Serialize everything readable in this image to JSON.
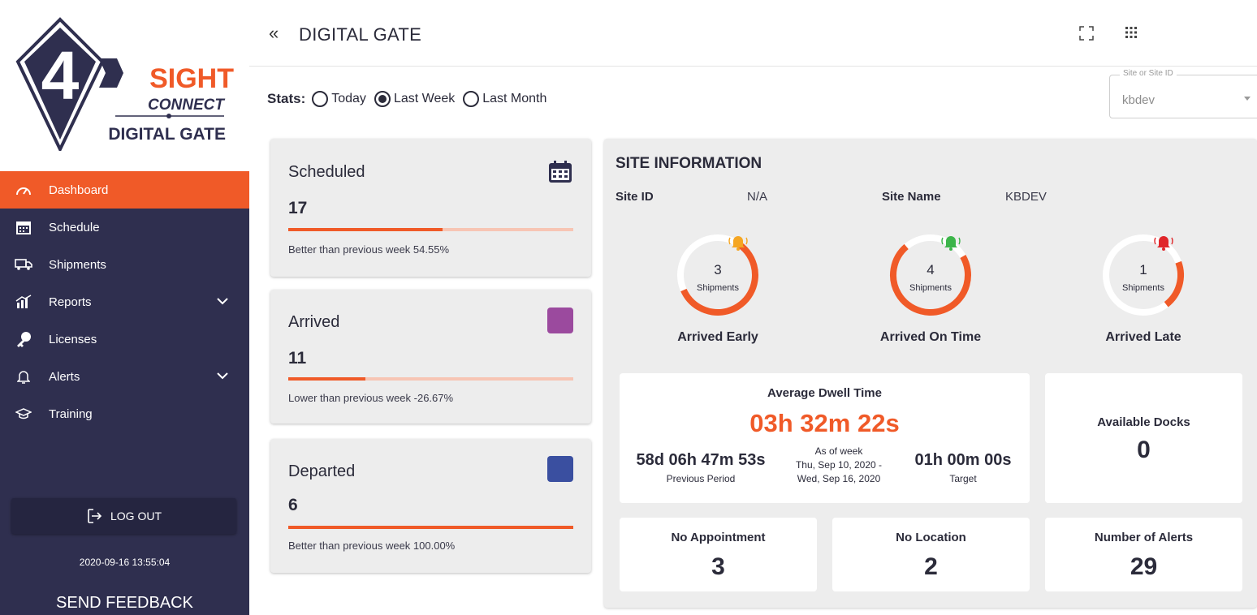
{
  "brand": {
    "logo_number": "4",
    "logo_word1": "SIGHT",
    "logo_word2": "CONNECT",
    "logo_word3": "DIGITAL GATE",
    "accent_color": "#f05a28",
    "sidebar_color": "#2f2f4f"
  },
  "sidebar": {
    "items": [
      {
        "label": "Dashboard",
        "icon": "speedometer-icon",
        "active": true
      },
      {
        "label": "Schedule",
        "icon": "calendar-icon"
      },
      {
        "label": "Shipments",
        "icon": "truck-icon"
      },
      {
        "label": "Reports",
        "icon": "bar-chart-icon",
        "expandable": true
      },
      {
        "label": "Licenses",
        "icon": "key-icon"
      },
      {
        "label": "Alerts",
        "icon": "bell-icon",
        "expandable": true
      },
      {
        "label": "Training",
        "icon": "graduation-cap-icon"
      }
    ],
    "logout_label": "LOG OUT",
    "datetime": "2020-09-16 13:55:04",
    "feedback_label": "SEND FEEDBACK"
  },
  "header": {
    "title": "DIGITAL GATE",
    "collapse_glyph": "«"
  },
  "stats": {
    "label": "Stats:",
    "options": [
      "Today",
      "Last Week",
      "Last Month"
    ],
    "selected": "Last Week"
  },
  "site_select": {
    "label": "Site or Site ID",
    "value": "kbdev"
  },
  "cards": [
    {
      "title": "Scheduled",
      "value": "17",
      "progress": 0.54,
      "note": "Better than previous week 54.55%",
      "icon": "calendar-icon"
    },
    {
      "title": "Arrived",
      "value": "11",
      "progress": 0.27,
      "note": "Lower than previous week -26.67%",
      "swatch_color": "#9b4a9e"
    },
    {
      "title": "Departed",
      "value": "6",
      "progress": 1.0,
      "note": "Better than previous week 100.00%",
      "swatch_color": "#3a4fa0"
    }
  ],
  "site_info": {
    "title": "SITE INFORMATION",
    "site_id_label": "Site ID",
    "site_id_value": "N/A",
    "site_name_label": "Site Name",
    "site_name_value": "KBDEV",
    "gauges": [
      {
        "count": "3",
        "unit": "Shipments",
        "label": "Arrived Early",
        "fraction": 0.6,
        "bell_color": "#f5a623"
      },
      {
        "count": "4",
        "unit": "Shipments",
        "label": "Arrived On Time",
        "fraction": 0.72,
        "bell_color": "#3cb54a"
      },
      {
        "count": "1",
        "unit": "Shipments",
        "label": "Arrived Late",
        "fraction": 0.2,
        "bell_color": "#e0262a"
      }
    ],
    "dwell": {
      "title": "Average Dwell Time",
      "value": "03h 32m 22s",
      "previous_value": "58d 06h 47m 53s",
      "previous_label": "Previous Period",
      "as_of_label": "As of week",
      "range_start": "Thu, Sep 10, 2020 -",
      "range_end": "Wed, Sep 16, 2020",
      "target_value": "01h 00m 00s",
      "target_label": "Target"
    },
    "available_docks": {
      "label": "Available Docks",
      "value": "0"
    },
    "no_appointment": {
      "label": "No Appointment",
      "value": "3"
    },
    "no_location": {
      "label": "No Location",
      "value": "2"
    },
    "alerts": {
      "label": "Number of Alerts",
      "value": "29"
    }
  }
}
